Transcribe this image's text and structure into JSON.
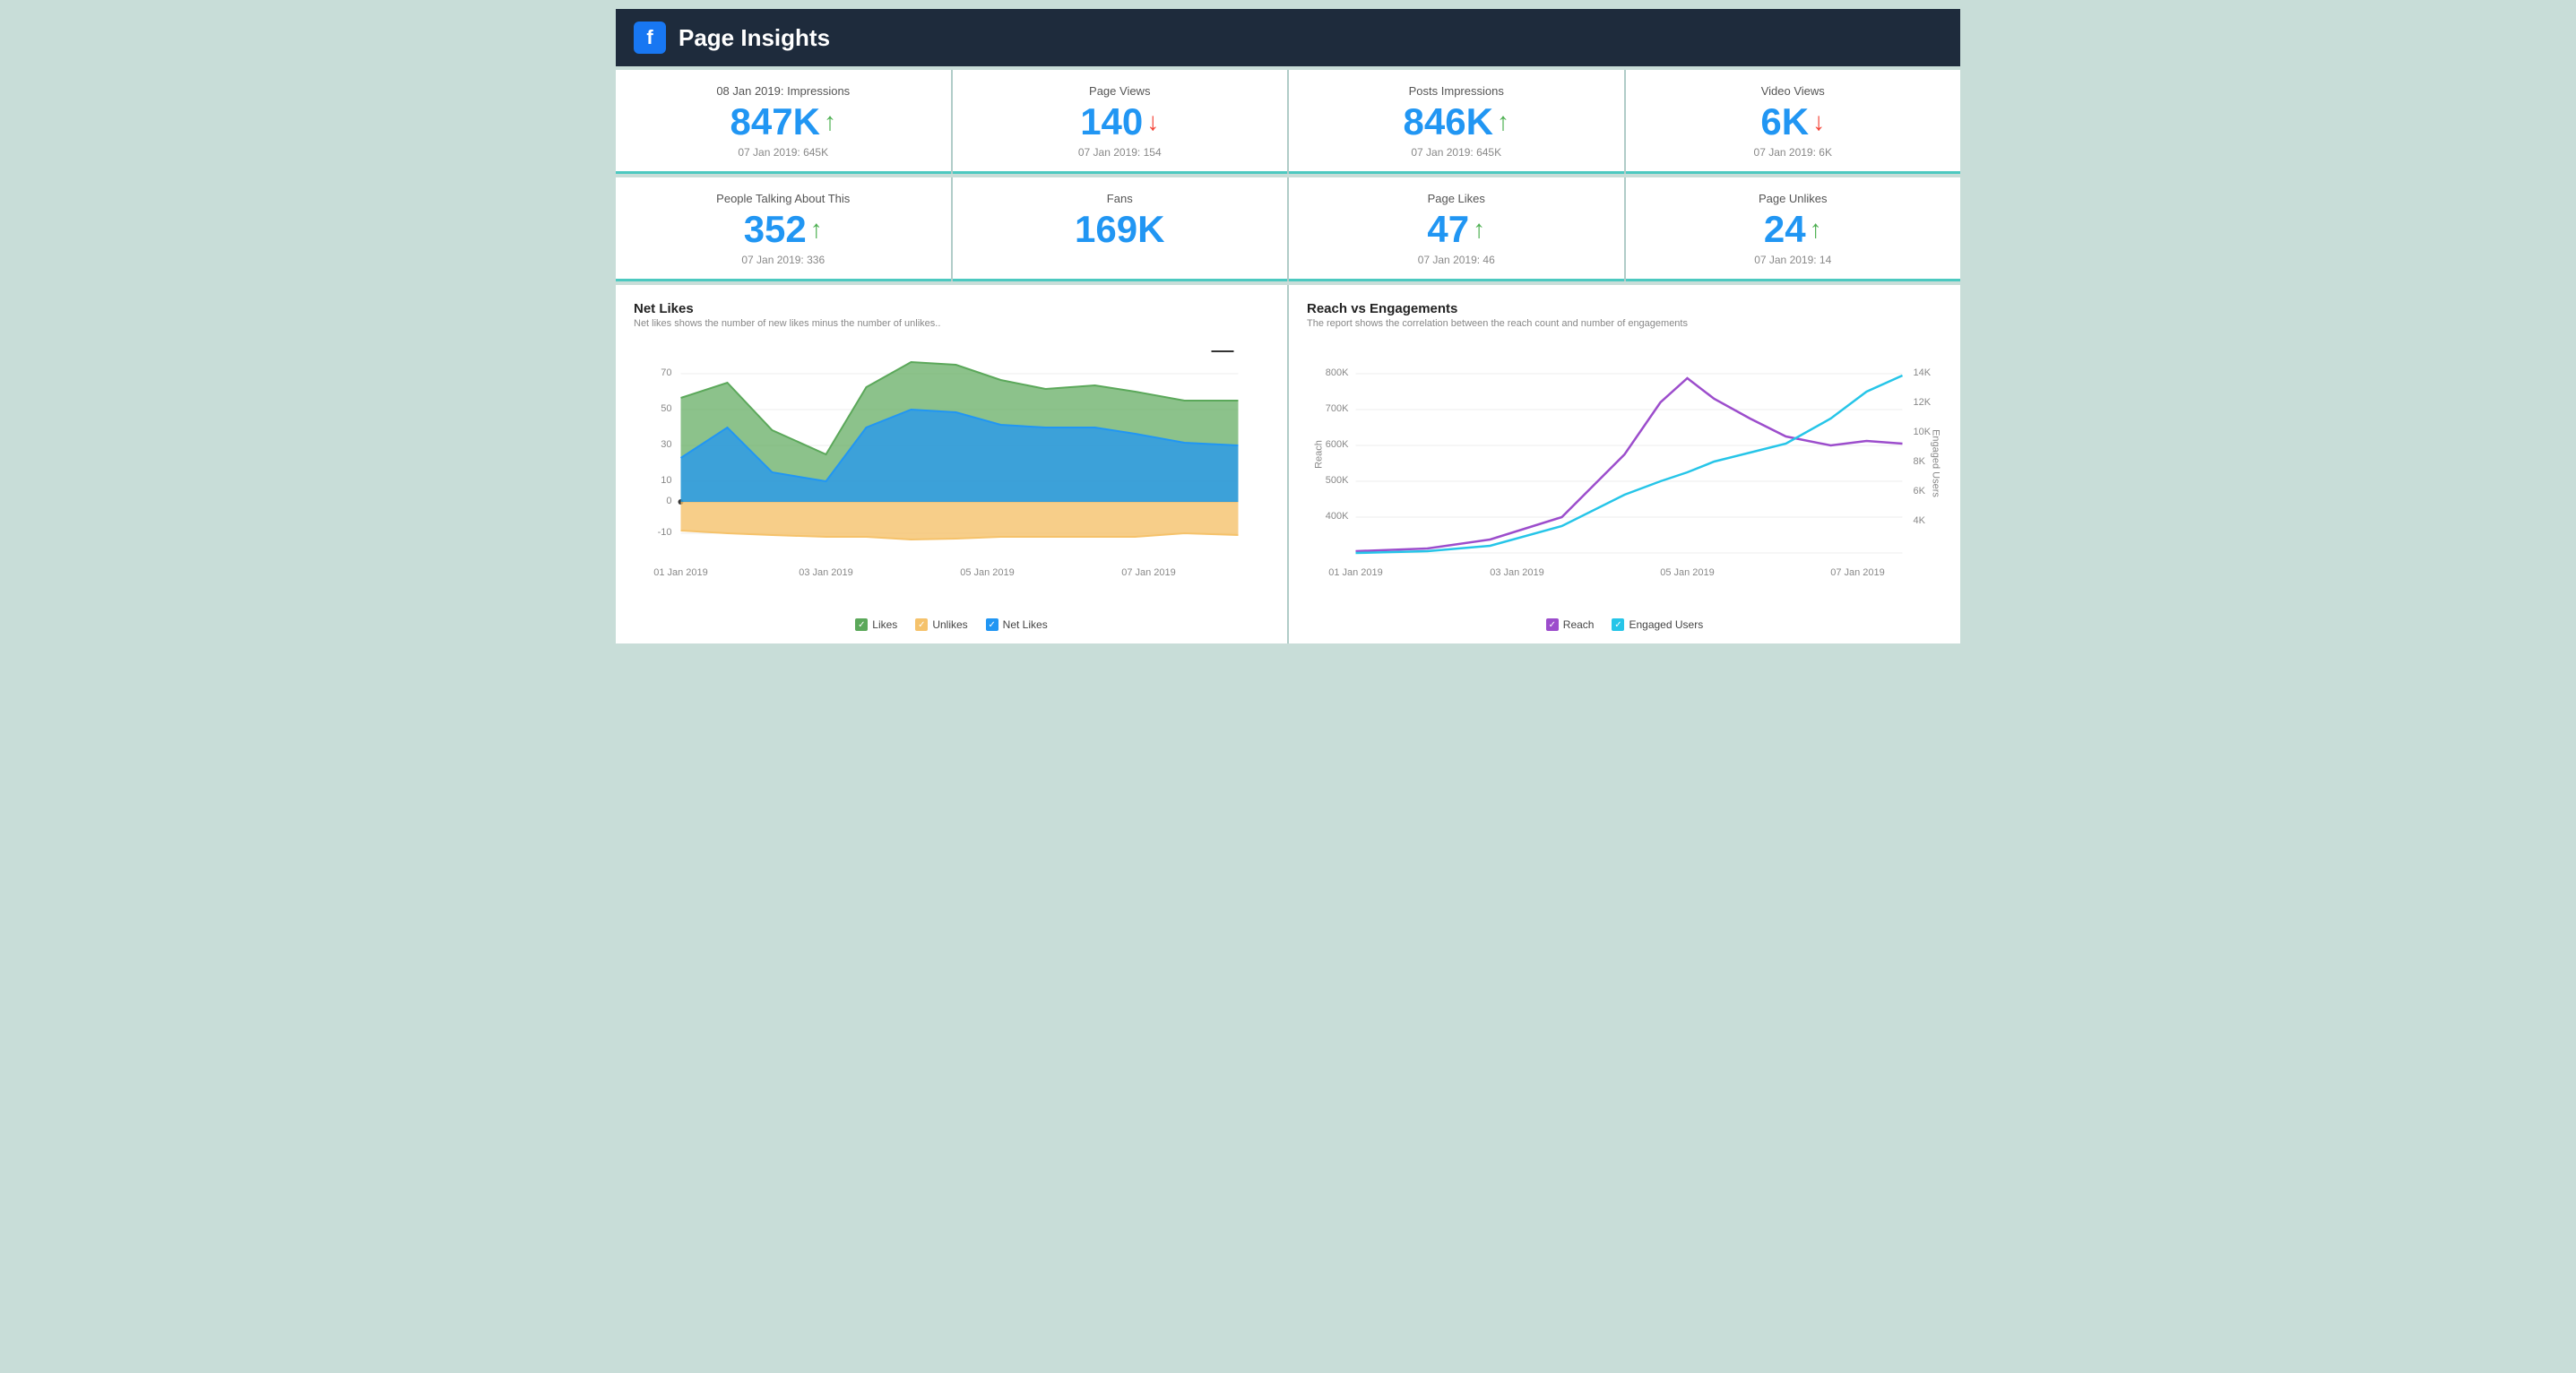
{
  "header": {
    "title": "Page Insights",
    "fb_label": "f"
  },
  "metrics_row1": [
    {
      "label": "08 Jan 2019: Impressions",
      "value": "847K",
      "trend": "up",
      "prev": "07 Jan 2019: 645K"
    },
    {
      "label": "Page Views",
      "value": "140",
      "trend": "down",
      "prev": "07 Jan 2019: 154"
    },
    {
      "label": "Posts Impressions",
      "value": "846K",
      "trend": "up",
      "prev": "07 Jan 2019: 645K"
    },
    {
      "label": "Video Views",
      "value": "6K",
      "trend": "down",
      "prev": "07 Jan 2019: 6K"
    }
  ],
  "metrics_row2": [
    {
      "label": "People Talking About This",
      "value": "352",
      "trend": "up",
      "prev": "07 Jan 2019: 336"
    },
    {
      "label": "Fans",
      "value": "169K",
      "trend": "none",
      "prev": ""
    },
    {
      "label": "Page Likes",
      "value": "47",
      "trend": "up",
      "prev": "07 Jan 2019: 46"
    },
    {
      "label": "Page Unlikes",
      "value": "24",
      "trend": "up",
      "prev": "07 Jan 2019: 14"
    }
  ],
  "net_likes_chart": {
    "title": "Net Likes",
    "subtitle": "Net likes shows the number of new likes minus the number of unlikes..",
    "x_labels": [
      "01 Jan 2019",
      "03 Jan 2019",
      "05 Jan 2019",
      "07 Jan 2019"
    ],
    "y_labels": [
      "70",
      "50",
      "30",
      "10",
      "0",
      "-10"
    ],
    "legend": [
      {
        "label": "Likes",
        "color": "#5ba85a"
      },
      {
        "label": "Unlikes",
        "color": "#f5c26b"
      },
      {
        "label": "Net Likes",
        "color": "#2196f3"
      }
    ]
  },
  "reach_chart": {
    "title": "Reach vs Engagements",
    "subtitle": "The report shows the correlation between the reach count and number of engagements",
    "x_labels": [
      "01 Jan 2019",
      "03 Jan 2019",
      "05 Jan 2019",
      "07 Jan 2019"
    ],
    "y_left_labels": [
      "800K",
      "700K",
      "600K",
      "500K",
      "400K"
    ],
    "y_right_labels": [
      "14K",
      "12K",
      "10K",
      "8K",
      "6K",
      "4K"
    ],
    "left_axis_label": "Reach",
    "right_axis_label": "Engaged Users",
    "legend": [
      {
        "label": "Reach",
        "color": "#9c4dcc"
      },
      {
        "label": "Engaged Users",
        "color": "#26c5e8"
      }
    ]
  }
}
